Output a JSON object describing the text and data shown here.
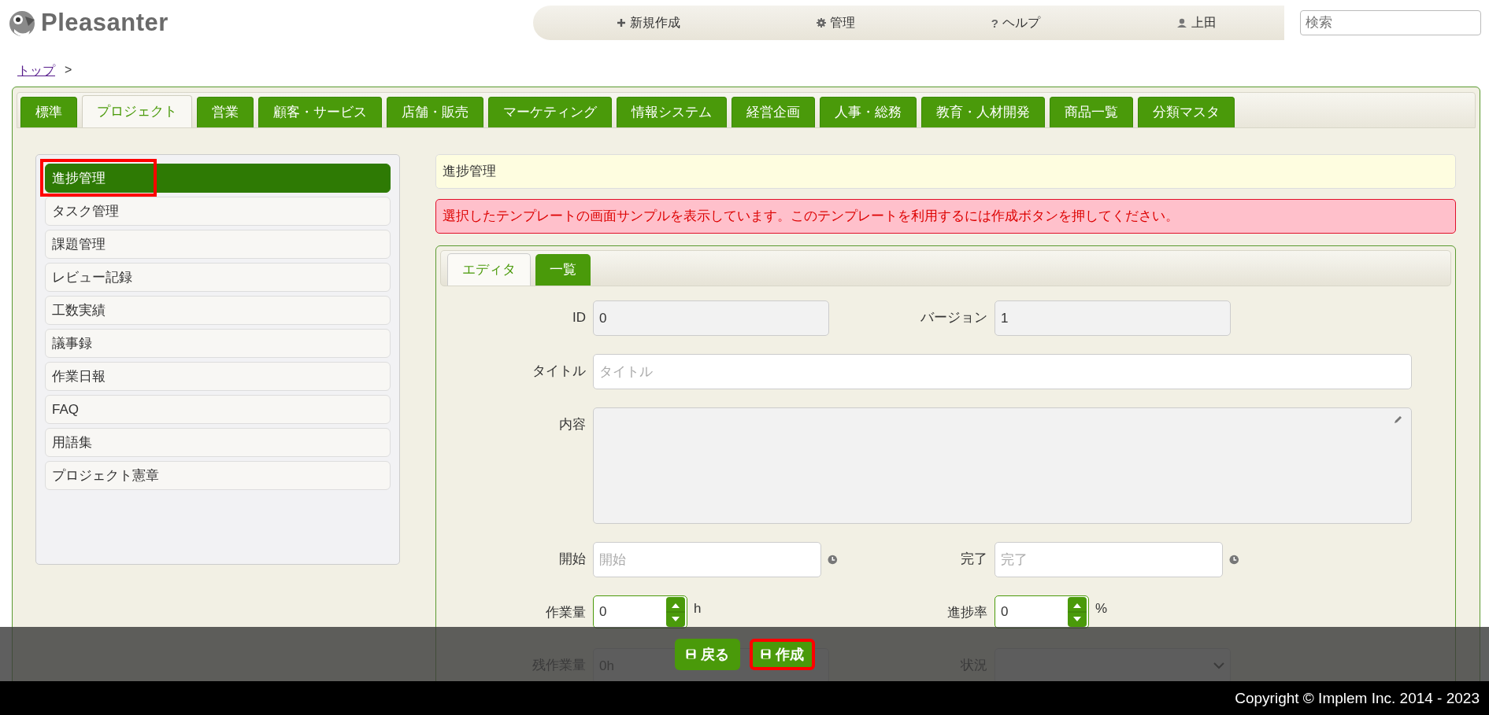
{
  "header": {
    "logo_text": "Pleasanter",
    "nav": [
      {
        "label": "新規作成"
      },
      {
        "label": "管理"
      },
      {
        "symbol": "?",
        "label": "ヘルプ"
      },
      {
        "label": "上田"
      }
    ],
    "search": {
      "placeholder": "検索"
    }
  },
  "breadcrumb": {
    "items": [
      "トップ"
    ],
    "separator": ">"
  },
  "tabs": [
    {
      "label": "標準",
      "selected": false
    },
    {
      "label": "プロジェクト",
      "selected": true
    },
    {
      "label": "営業",
      "selected": false
    },
    {
      "label": "顧客・サービス",
      "selected": false
    },
    {
      "label": "店舗・販売",
      "selected": false
    },
    {
      "label": "マーケティング",
      "selected": false
    },
    {
      "label": "情報システム",
      "selected": false
    },
    {
      "label": "経営企画",
      "selected": false
    },
    {
      "label": "人事・総務",
      "selected": false
    },
    {
      "label": "教育・人材開発",
      "selected": false
    },
    {
      "label": "商品一覧",
      "selected": false
    },
    {
      "label": "分類マスタ",
      "selected": false
    }
  ],
  "sidebar": {
    "items": [
      {
        "label": "進捗管理",
        "selected": true,
        "highlighted": true
      },
      {
        "label": "タスク管理",
        "selected": false,
        "highlighted": false
      },
      {
        "label": "課題管理",
        "selected": false,
        "highlighted": false
      },
      {
        "label": "レビュー記録",
        "selected": false,
        "highlighted": false
      },
      {
        "label": "工数実績",
        "selected": false,
        "highlighted": false
      },
      {
        "label": "議事録",
        "selected": false,
        "highlighted": false
      },
      {
        "label": "作業日報",
        "selected": false,
        "highlighted": false
      },
      {
        "label": "FAQ",
        "selected": false,
        "highlighted": false
      },
      {
        "label": "用語集",
        "selected": false,
        "highlighted": false
      },
      {
        "label": "プロジェクト憲章",
        "selected": false,
        "highlighted": false
      }
    ]
  },
  "title_box": "進捗管理",
  "alert": "選択したテンプレートの画面サンプルを表示しています。このテンプレートを利用するには作成ボタンを押してください。",
  "editor_tabs": [
    {
      "label": "エディタ",
      "selected": true
    },
    {
      "label": "一覧",
      "selected": false
    }
  ],
  "form_rows": [
    [
      {
        "kind": "readonly",
        "label": "ID",
        "value": "0"
      },
      {
        "kind": "readonly",
        "label": "バージョン",
        "value": "1"
      }
    ],
    [
      {
        "kind": "text",
        "label": "タイトル",
        "placeholder": "タイトル"
      }
    ],
    [
      {
        "kind": "textarea",
        "label": "内容"
      }
    ],
    [
      {
        "kind": "date",
        "label": "開始",
        "placeholder": "開始"
      },
      {
        "kind": "date",
        "label": "完了",
        "placeholder": "完了"
      }
    ],
    [
      {
        "kind": "number",
        "label": "作業量",
        "value": "0",
        "unit": "h"
      },
      {
        "kind": "number",
        "label": "進捗率",
        "value": "0",
        "unit": "%"
      }
    ],
    [
      {
        "kind": "readonly",
        "label": "残作業量",
        "value": "0h"
      },
      {
        "kind": "select",
        "label": "状況"
      }
    ]
  ],
  "commands": [
    {
      "label": "戻る",
      "highlighted": false
    },
    {
      "label": "作成",
      "highlighted": true
    }
  ],
  "footer": "Copyright © Implem Inc. 2014 - 2023"
}
